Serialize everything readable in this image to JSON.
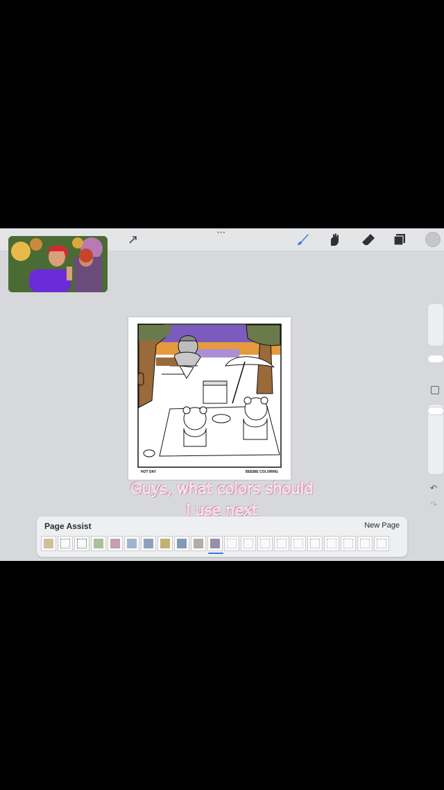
{
  "page_assist": {
    "title": "Page Assist",
    "new_page_label": "New Page",
    "pages": [
      {
        "tone": "#c9b48a",
        "filled": true
      },
      {
        "tone": "#777777",
        "filled": false
      },
      {
        "tone": "#555555",
        "filled": false
      },
      {
        "tone": "#9bb48a",
        "filled": true
      },
      {
        "tone": "#b88fa0",
        "filled": true
      },
      {
        "tone": "#8fa7c8",
        "filled": true
      },
      {
        "tone": "#7a8fb0",
        "filled": true
      },
      {
        "tone": "#b3a45c",
        "filled": true
      },
      {
        "tone": "#6f8aa8",
        "filled": true
      },
      {
        "tone": "#a6a090",
        "filled": true
      },
      {
        "tone": "#8a7a9a",
        "filled": true,
        "selected": true
      },
      {
        "tone": "#bbbbbb",
        "filled": false
      },
      {
        "tone": "#aaaaaa",
        "filled": false
      },
      {
        "tone": "#b0b0b0",
        "filled": false
      },
      {
        "tone": "#a8a8a8",
        "filled": false
      },
      {
        "tone": "#b5b5b5",
        "filled": false
      },
      {
        "tone": "#a0a0a0",
        "filled": false
      },
      {
        "tone": "#b8b8b8",
        "filled": false
      },
      {
        "tone": "#ababab",
        "filled": false
      },
      {
        "tone": "#b2b2b2",
        "filled": false
      },
      {
        "tone": "#a4a4a4",
        "filled": false
      }
    ]
  },
  "artwork": {
    "left_caption": "HOT DAY",
    "right_caption": "BEEBIE COLORING"
  },
  "caption": {
    "line1": "Guys, what colors should",
    "line2": "I use next"
  },
  "toolbar": {
    "tools": [
      "arrow-icon",
      "brush-icon",
      "smudge-icon",
      "eraser-icon",
      "layers-icon"
    ]
  },
  "colors": {
    "accent": "#2a7de1",
    "caption_pink": "#f4a8c9",
    "sky_purple": "#7a5ab8",
    "sunset_orange": "#e89a3c",
    "tree_brown": "#9a6a3a",
    "foliage_green": "#6a7a4a"
  }
}
